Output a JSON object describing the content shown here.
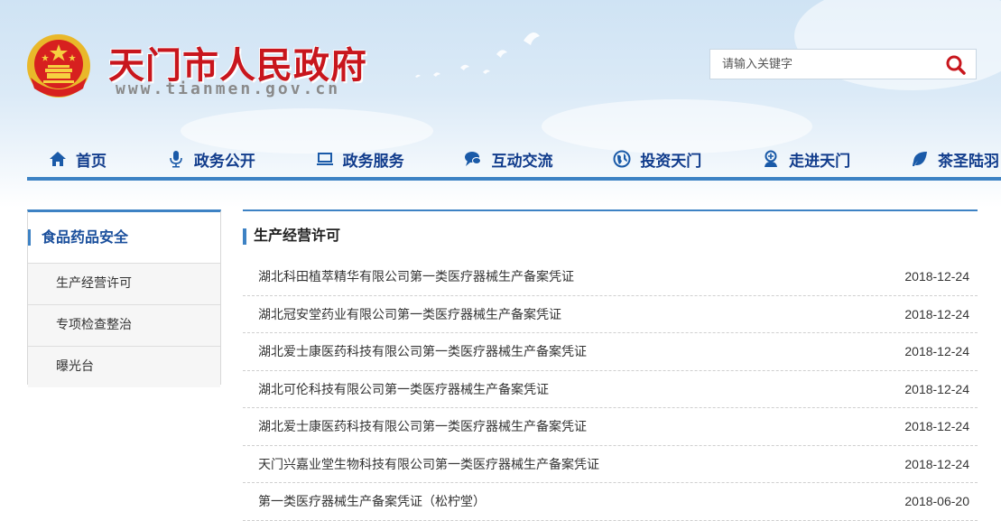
{
  "header": {
    "site_title": "天门市人民政府",
    "site_domain": "www.tianmen.gov.cn",
    "colors": {
      "title_red": "#c8161d",
      "nav_blue": "#113c8c",
      "accent_blue": "#3d82c4",
      "emblem_gold": "#f0c020"
    }
  },
  "search": {
    "placeholder": "请输入关键字",
    "button_icon": "search-icon"
  },
  "nav": {
    "items": [
      {
        "label": "首页",
        "icon": "home-icon"
      },
      {
        "label": "政务公开",
        "icon": "microphone-icon"
      },
      {
        "label": "政务服务",
        "icon": "monitor-icon"
      },
      {
        "label": "互动交流",
        "icon": "chat-icon"
      },
      {
        "label": "投资天门",
        "icon": "globe-icon"
      },
      {
        "label": "走进天门",
        "icon": "person-badge-icon"
      },
      {
        "label": "茶圣陆羽",
        "icon": "leaf-icon"
      }
    ]
  },
  "sidebar": {
    "title": "食品药品安全",
    "items": [
      {
        "label": "生产经营许可"
      },
      {
        "label": "专项检查整治"
      },
      {
        "label": "曝光台"
      }
    ]
  },
  "main": {
    "section_title": "生产经营许可",
    "rows": [
      {
        "title": "湖北科田植萃精华有限公司第一类医疗器械生产备案凭证",
        "date": "2018-12-24"
      },
      {
        "title": "湖北冠安堂药业有限公司第一类医疗器械生产备案凭证",
        "date": "2018-12-24"
      },
      {
        "title": "湖北爱士康医药科技有限公司第一类医疗器械生产备案凭证",
        "date": "2018-12-24"
      },
      {
        "title": "湖北可伦科技有限公司第一类医疗器械生产备案凭证",
        "date": "2018-12-24"
      },
      {
        "title": "湖北爱士康医药科技有限公司第一类医疗器械生产备案凭证",
        "date": "2018-12-24"
      },
      {
        "title": "天门兴嘉业堂生物科技有限公司第一类医疗器械生产备案凭证",
        "date": "2018-12-24"
      },
      {
        "title": "第一类医疗器械生产备案凭证（松柠堂）",
        "date": "2018-06-20"
      }
    ]
  }
}
